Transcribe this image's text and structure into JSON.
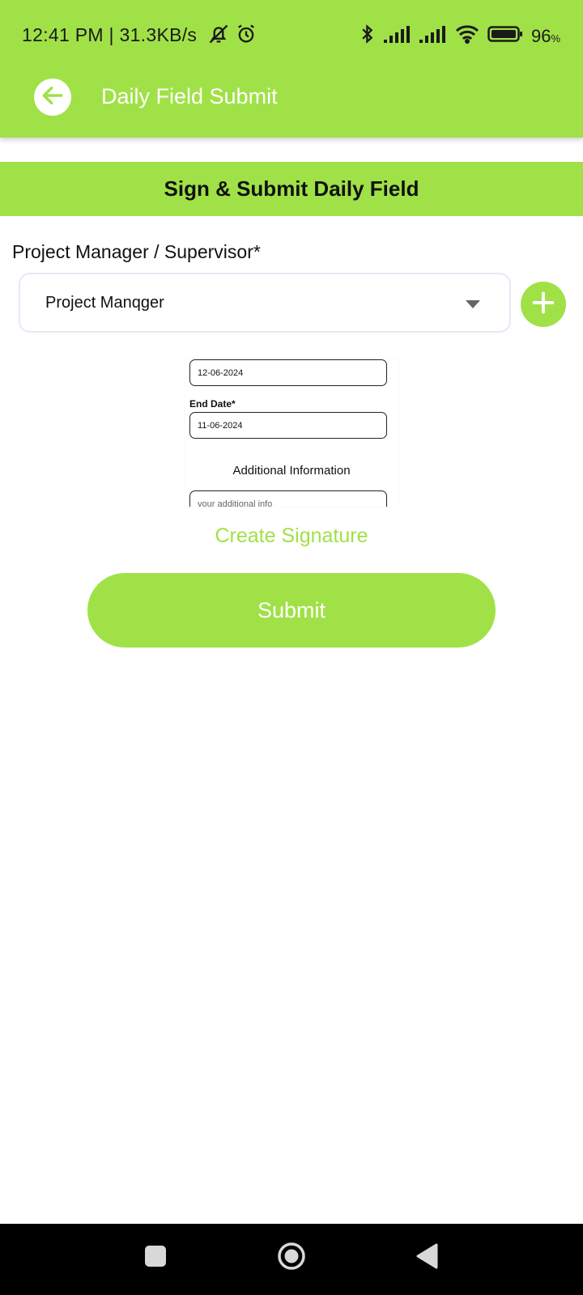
{
  "status_bar": {
    "time_speed": "12:41 PM | 31.3KB/s",
    "battery_value": "96",
    "battery_unit": "%",
    "icons": [
      "bell-muted-icon",
      "alarm-icon",
      "bluetooth-icon",
      "signal-icon",
      "signal-icon",
      "wifi-icon",
      "battery-icon"
    ]
  },
  "header": {
    "title": "Daily Field Submit",
    "back_icon": "arrow-left-icon"
  },
  "banner": {
    "title": "Sign & Submit Daily Field"
  },
  "form": {
    "manager_label": "Project Manager / Supervisor*",
    "manager_selected": "Project Manqger",
    "add_icon": "plus-icon"
  },
  "preview": {
    "start_date_value": "12-06-2024",
    "end_date_label": "End Date*",
    "end_date_value": "11-06-2024",
    "additional_heading": "Additional Information",
    "additional_placeholder": "your additional info"
  },
  "actions": {
    "create_signature": "Create Signature",
    "submit": "Submit"
  },
  "colors": {
    "accent": "#a0e147",
    "nav_background": "#000000"
  }
}
